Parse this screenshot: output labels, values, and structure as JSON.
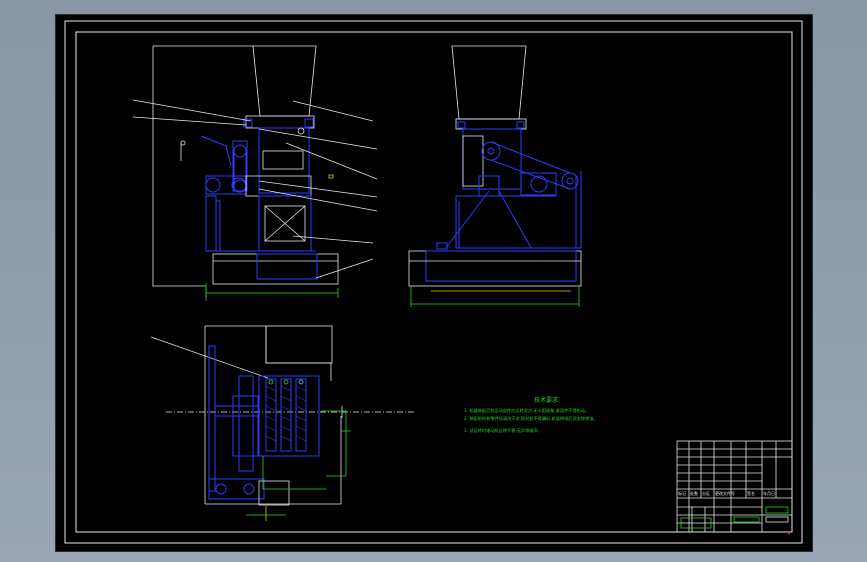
{
  "tech_notes": {
    "title": "技术要求",
    "lines": [
      "1. 机器装配后各运动部件应运转灵活,无卡阻现象,紧固件不得松动。",
      "2. 装配前所有零件须清洗干净,密封处不得漏料,机架焊接后须去除焊渣。",
      "3. 试运转时电动机运转平稳,无异常噪声。"
    ]
  },
  "title_block": {
    "drawing_name": "",
    "scale": "",
    "labels": [
      "标记",
      "处数",
      "分区",
      "更改文件号",
      "签名",
      "年月日"
    ]
  },
  "colors": {
    "background": "#000000",
    "outline": "#e8e8e8",
    "part": "#2c3cff",
    "dimension": "#24d424",
    "center": "#40e0ff",
    "accent": "#e6d000"
  }
}
